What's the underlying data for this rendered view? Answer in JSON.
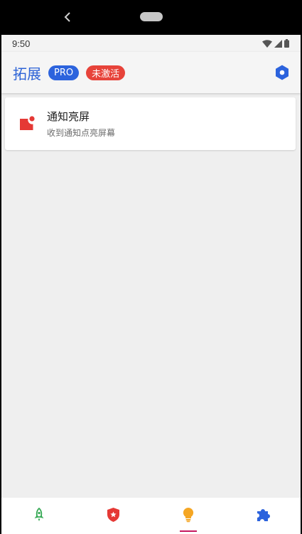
{
  "status": {
    "time": "9:50"
  },
  "appbar": {
    "title": "拓展",
    "pro_badge": "PRO",
    "inactive_badge": "未激活"
  },
  "card": {
    "title": "通知亮屏",
    "subtitle": "收到通知点亮屏幕"
  },
  "bottom_nav": {
    "items": [
      {
        "icon": "rocket-icon",
        "color": "#34a853"
      },
      {
        "icon": "shield-star-icon",
        "color": "#e53935"
      },
      {
        "icon": "lightbulb-icon",
        "color": "#f5a623",
        "active": true
      },
      {
        "icon": "puzzle-icon",
        "color": "#2c63dd"
      }
    ]
  },
  "colors": {
    "accent": "#2c63dd",
    "danger": "#e7433a",
    "active_indicator": "#c5185f"
  }
}
